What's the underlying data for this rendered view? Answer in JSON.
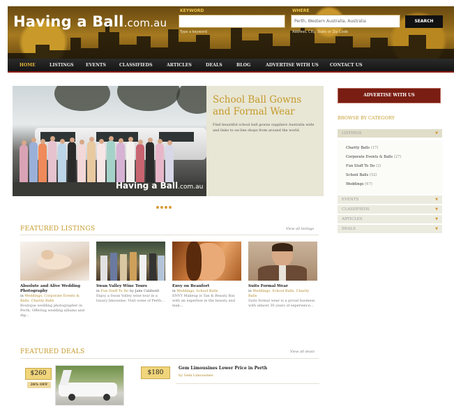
{
  "header": {
    "logo_main": "Having a Ball",
    "logo_domain": ".com.au",
    "keyword_label": "KEYWORD",
    "keyword_hint": "Type a keyword",
    "where_label": "WHERE",
    "where_value": "Perth, Western Australia, Australia",
    "where_hint": "Address, City, State or Zip Code",
    "search_label": "SEARCH"
  },
  "nav": {
    "items": [
      "HOME",
      "LISTINGS",
      "EVENTS",
      "CLASSIFIEDS",
      "ARTICLES",
      "DEALS",
      "BLOG",
      "ADVERTISE WITH US",
      "CONTACT US"
    ]
  },
  "slider": {
    "title": "School Ball Gowns and Formal Wear",
    "text": "Find beautiful school ball gowns suppliers Australia wide and links to on-line shops from around the world.",
    "photo_logo_main": "Having a Ball",
    "photo_logo_domain": ".com.au",
    "dot_count": 4
  },
  "featured_listings": {
    "title": "FEATURED LISTINGS",
    "view_all": "View all listings",
    "items": [
      {
        "title": "Absolute and Alive Wedding Photography",
        "in": "in",
        "category": "Weddings, Corporate Events & Balls, Charity Balls",
        "desc": "Boutique wedding photographer in Perth. Offering wedding albums and dig..."
      },
      {
        "title": "Swan Valley Wine Tours",
        "in": "in",
        "category": "Fun Stuff To Do",
        "by": "by Jake Caldwell",
        "desc": "Enjoy a Swan Valley wine tour in a luxury limousine. Visit some of Perth..."
      },
      {
        "title": "Envy on Beaufort",
        "in": "in",
        "category": "Weddings, School Balls",
        "desc": "ENVY Makeup is Tan & Beauty Bar, with an expertise in the beauty and mak..."
      },
      {
        "title": "Suits Formal Wear",
        "in": "in",
        "category": "Weddings, School Balls, Charity Balls",
        "desc": "Suits formal wear is a proud business with almost 30 years of experience..."
      }
    ]
  },
  "featured_deals": {
    "title": "FEATURED DEALS",
    "view_all": "View all deals",
    "deal1": {
      "price": "$260",
      "off": "26% OFF"
    },
    "deal2": {
      "price": "$180",
      "title": "Gem Limousines Lower Price in Perth",
      "by": "by Gem Limousines"
    }
  },
  "sidebar": {
    "advertise": "ADVERTISE WITH US",
    "browse_title": "BROWSE BY CATEGORY",
    "listings_label": "LISTINGS",
    "categories": [
      {
        "name": "Charity Balls",
        "count": "(17)"
      },
      {
        "name": "Corporate Events & Balls",
        "count": "(27)"
      },
      {
        "name": "Fun Stuff To Do",
        "count": "(2)"
      },
      {
        "name": "School Balls",
        "count": "(52)"
      },
      {
        "name": "Weddings",
        "count": "(67)"
      }
    ],
    "other_sections": [
      "EVENTS",
      "CLASSIFIEDS",
      "ARTICLES",
      "DEALS"
    ]
  },
  "colors": {
    "accent_gold": "#c49a2a",
    "nav_bg": "#1c1c1c",
    "advertise_red": "#7a1d12",
    "panel_beige": "#e8e6d5"
  }
}
